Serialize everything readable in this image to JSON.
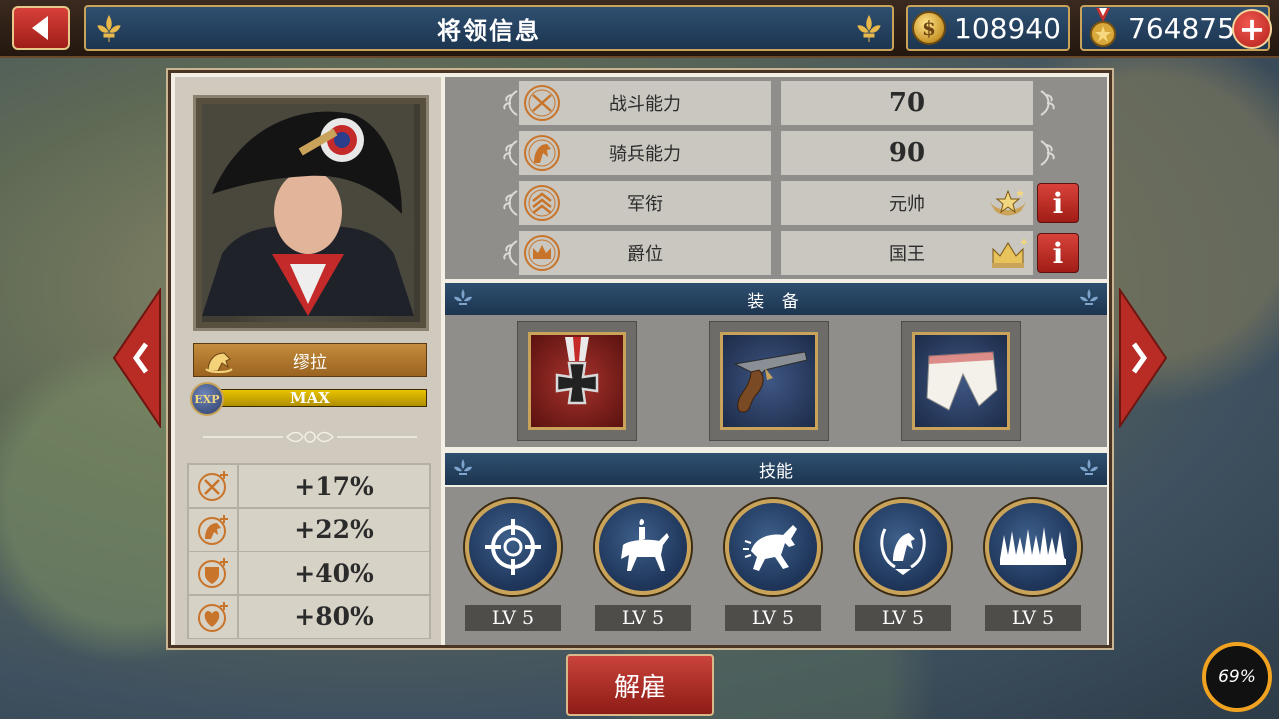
{
  "header": {
    "title": "将领信息",
    "gold": "108940",
    "medals": "764875"
  },
  "general": {
    "name": "缪拉",
    "exp_label": "EXP",
    "exp_value": "MAX",
    "bonuses": [
      {
        "icon": "swords-plus-icon",
        "value": "+17%"
      },
      {
        "icon": "horse-plus-icon",
        "value": "+22%"
      },
      {
        "icon": "shield-plus-icon",
        "value": "+40%"
      },
      {
        "icon": "heart-plus-icon",
        "value": "+80%"
      }
    ]
  },
  "stats": [
    {
      "icon": "crossed-swords-icon",
      "label": "战斗能力",
      "value": "70"
    },
    {
      "icon": "horse-head-icon",
      "label": "骑兵能力",
      "value": "90"
    },
    {
      "icon": "chevron-rank-icon",
      "label": "军衔",
      "value": "元帅",
      "badge": "marshal-stars-icon"
    },
    {
      "icon": "crown-icon",
      "label": "爵位",
      "value": "国王",
      "badge": "king-crown-icon"
    }
  ],
  "equipment": {
    "title": "装 备",
    "items": [
      "iron-cross-medal-icon",
      "flintlock-pistol-icon",
      "white-trousers-icon"
    ]
  },
  "skills": {
    "title": "技能",
    "items": [
      {
        "icon": "crosshair-icon",
        "level": "LV 5"
      },
      {
        "icon": "mounted-rider-icon",
        "level": "LV 5"
      },
      {
        "icon": "charging-cavalry-icon",
        "level": "LV 5"
      },
      {
        "icon": "horse-laurel-icon",
        "level": "LV 5"
      },
      {
        "icon": "spike-wall-icon",
        "level": "LV 5"
      }
    ]
  },
  "dismiss_label": "解雇",
  "fps_gauge": "69%",
  "colors": {
    "accent_red": "#c9433b",
    "navy": "#1c3550",
    "gold": "#c9a35a"
  }
}
